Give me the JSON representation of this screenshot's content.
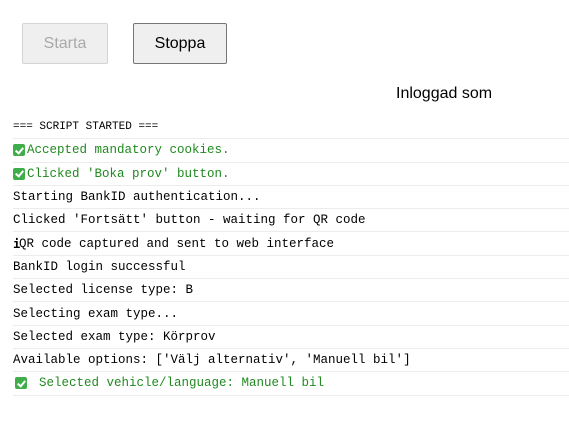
{
  "buttons": {
    "start_label": "Starta",
    "stop_label": "Stoppa"
  },
  "status": {
    "logged_in_label": "Inloggad som"
  },
  "log": {
    "lines": [
      {
        "text": "=== SCRIPT STARTED ===",
        "type": "header"
      },
      {
        "text": "Accepted mandatory cookies.",
        "type": "success",
        "icon": "check-icon"
      },
      {
        "text": "Clicked 'Boka prov' button.",
        "type": "success",
        "icon": "check-icon"
      },
      {
        "text": "Starting BankID authentication...",
        "type": "normal"
      },
      {
        "text": "Clicked 'Fortsätt' button - waiting for QR code",
        "type": "normal"
      },
      {
        "text": "QR code captured and sent to web interface",
        "type": "normal",
        "icon": "info-icon"
      },
      {
        "text": "BankID login successful",
        "type": "normal"
      },
      {
        "text": "Selected license type: B",
        "type": "normal"
      },
      {
        "text": "Selecting exam type...",
        "type": "normal"
      },
      {
        "text": "Selected exam type: Körprov",
        "type": "normal"
      },
      {
        "text": "Available options: ['Välj alternativ', 'Manuell bil']",
        "type": "normal"
      },
      {
        "text": "Selected vehicle/language: Manuell bil",
        "type": "success",
        "icon": "check-icon"
      }
    ]
  },
  "colors": {
    "success_text": "#1f8a1f",
    "check_bg": "#3fae4a",
    "row_divider": "#ececec"
  }
}
